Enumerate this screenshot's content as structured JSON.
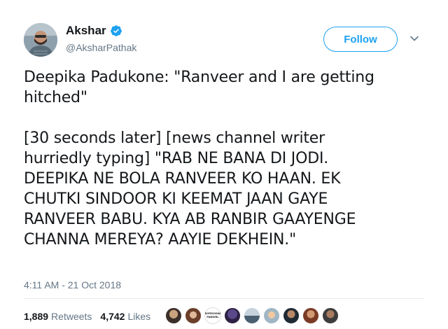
{
  "user": {
    "name": "Akshar",
    "handle": "@AksharPathak"
  },
  "actions": {
    "follow_label": "Follow"
  },
  "tweet": {
    "line1": "Deepika Padukone: \"Ranveer and I are getting\nhitched\"",
    "line2": "[30 seconds later] [news channel writer\nhurriedly typing] \"RAB NE BANA DI JODI.\nDEEPIKA NE BOLA RANVEER KO HAAN. EK\nCHUTKI SINDOOR KI KEEMAT JAAN GAYE\nRANVEER BABU. KYA AB RANBIR GAAYENGE\nCHANNA MEREYA? AAYIE DEKHEIN.\"",
    "timestamp": "4:11 AM - 21 Oct 2018"
  },
  "stats": {
    "retweets_count": "1,889",
    "retweets_label": "Retweets",
    "likes_count": "4,742",
    "likes_label": "Likes"
  },
  "likers": {
    "badge_text": "PROFESSIONAL FANGIRL"
  },
  "colors": {
    "accent": "#1da1f2",
    "secondary_text": "#657786",
    "primary_text": "#14171a"
  }
}
